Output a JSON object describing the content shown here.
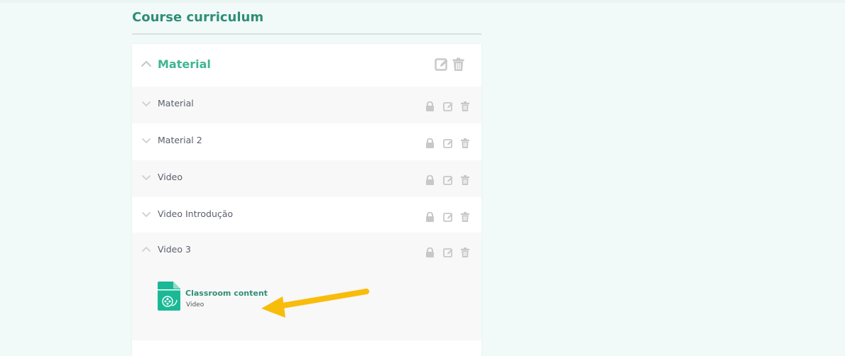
{
  "page": {
    "title": "Course curriculum"
  },
  "section": {
    "title": "Material",
    "expanded": true
  },
  "lessons": [
    {
      "title": "Material",
      "expanded": false
    },
    {
      "title": "Material 2",
      "expanded": false
    },
    {
      "title": "Video",
      "expanded": false
    },
    {
      "title": "Video Introdução",
      "expanded": false
    },
    {
      "title": "Video 3",
      "expanded": true
    }
  ],
  "content": {
    "title": "Classroom content",
    "type": "Video",
    "icon": "video-file-icon"
  },
  "colors": {
    "accent": "#3fb592",
    "title": "#2f8e77",
    "icon_grey": "#c8c8c8",
    "file_icon": "#1bb896",
    "arrow": "#f8bc0b"
  }
}
